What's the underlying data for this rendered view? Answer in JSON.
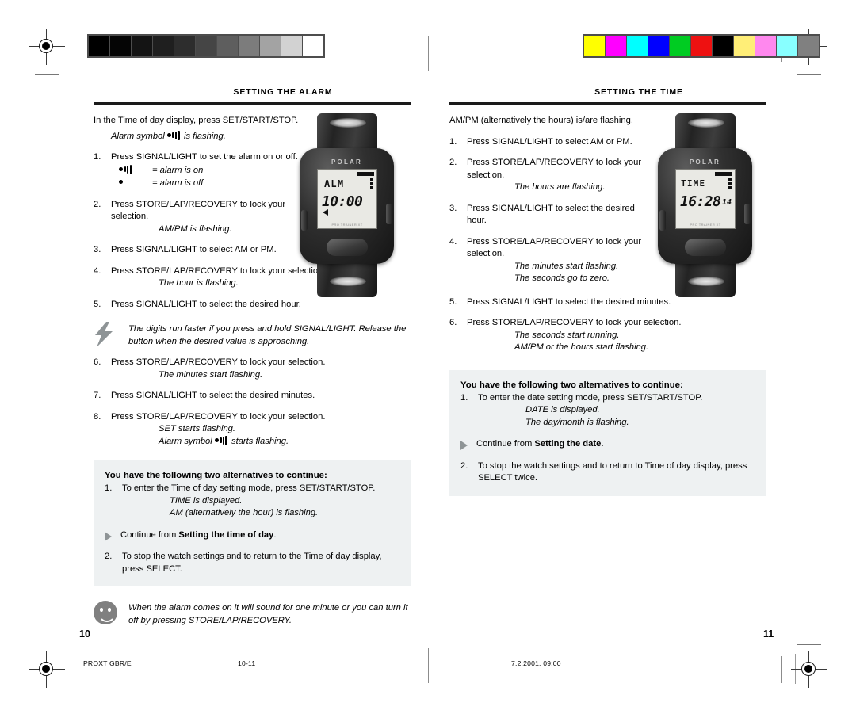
{
  "document": {
    "imposition_label": "PROXT GBR/E",
    "sheet_label": "10-11",
    "print_timestamp": "7.2.2001, 09:00"
  },
  "calibration": {
    "grayscale_patches": [
      "#000000",
      "#050505",
      "#141414",
      "#1f1f1f",
      "#2d2d2d",
      "#454545",
      "#5e5e5e",
      "#7c7c7c",
      "#a3a3a3",
      "#d2d2d2",
      "#ffffff"
    ],
    "color_patches": [
      "#ffff00",
      "#ff00ff",
      "#00ffff",
      "#0000ff",
      "#00cc22",
      "#ee1111",
      "#000000",
      "#ffee77",
      "#ff88ee",
      "#88ffff",
      "#808080"
    ]
  },
  "left_page": {
    "page_number": "10",
    "heading": "SETTING THE ALARM",
    "intro": "In the Time of day display, press SET/START/STOP.",
    "intro_note_prefix": "Alarm symbol",
    "intro_note_suffix": "is flashing.",
    "watch": {
      "brand": "POLAR",
      "lcd_mode": "ALM",
      "lcd_main": "10:00",
      "lcd_small": "",
      "lcd_foot": "PRO TRAINER XT"
    },
    "steps": [
      {
        "num": "1.",
        "text": "Press SIGNAL/LIGHT to set the alarm on or off.",
        "symbol_rows": [
          {
            "symbol": "alarm-on-icon",
            "label": "= alarm is on"
          },
          {
            "symbol": "alarm-off-icon",
            "label": "= alarm is off"
          }
        ],
        "subs": []
      },
      {
        "num": "2.",
        "text": "Press STORE/LAP/RECOVERY to lock your selection.",
        "subs": [
          "AM/PM is flashing."
        ]
      },
      {
        "num": "3.",
        "text": "Press SIGNAL/LIGHT to select AM or PM.",
        "subs": []
      },
      {
        "num": "4.",
        "text": "Press STORE/LAP/RECOVERY to lock your selection.",
        "subs": [
          "The hour is flashing."
        ]
      },
      {
        "num": "5.",
        "text": "Press SIGNAL/LIGHT to select the desired hour.",
        "subs": []
      },
      {
        "num": "6.",
        "text": "Press STORE/LAP/RECOVERY to lock your selection.",
        "subs": [
          "The minutes start flashing."
        ]
      },
      {
        "num": "7.",
        "text": "Press SIGNAL/LIGHT to select the desired minutes.",
        "subs": []
      },
      {
        "num": "8.",
        "text": "Press STORE/LAP/RECOVERY to lock your selection.",
        "subs": [
          "SET starts flashing."
        ],
        "sub_with_symbol": {
          "prefix": "Alarm symbol",
          "suffix": "starts flashing."
        }
      }
    ],
    "tip_bolt": "The digits run faster if you press and hold SIGNAL/LIGHT. Release the button when the desired value is approaching.",
    "alt_box": {
      "title": "You have the following two alternatives to continue:",
      "item1_num": "1.",
      "item1_text": "To enter the Time of day setting mode, press SET/START/STOP.",
      "item1_subs": [
        "TIME is displayed.",
        "AM (alternatively the hour) is flashing."
      ],
      "continue_prefix": "Continue from",
      "continue_bold": "Setting the time of day",
      "continue_suffix": ".",
      "item2_num": "2.",
      "item2_text": "To stop the watch settings and to return to the Time of day display, press SELECT."
    },
    "tip_smiley": "When the alarm comes on it will sound for one minute or you can turn it off by pressing STORE/LAP/RECOVERY."
  },
  "right_page": {
    "page_number": "11",
    "heading": "SETTING THE TIME",
    "intro": "AM/PM (alternatively the hours) is/are flashing.",
    "watch": {
      "brand": "POLAR",
      "lcd_mode": "TIME",
      "lcd_main": "16:28",
      "lcd_small": "14",
      "lcd_foot": "PRO TRAINER XT"
    },
    "steps": [
      {
        "num": "1.",
        "text": "Press SIGNAL/LIGHT to select AM or PM.",
        "subs": []
      },
      {
        "num": "2.",
        "text": "Press STORE/LAP/RECOVERY to lock your selection.",
        "subs": [
          "The hours are flashing."
        ]
      },
      {
        "num": "3.",
        "text": "Press SIGNAL/LIGHT to select the desired hour.",
        "subs": []
      },
      {
        "num": "4.",
        "text": "Press STORE/LAP/RECOVERY to lock your selection.",
        "subs": [
          "The minutes start flashing.",
          "The seconds go to zero."
        ]
      },
      {
        "num": "5.",
        "text": "Press SIGNAL/LIGHT to select the desired minutes.",
        "subs": []
      },
      {
        "num": "6.",
        "text": "Press STORE/LAP/RECOVERY to lock your selection.",
        "subs": [
          "The seconds start running.",
          "AM/PM or the hours start flashing."
        ]
      }
    ],
    "alt_box": {
      "title": "You have the following two alternatives to continue:",
      "item1_num": "1.",
      "item1_text": "To enter the date setting mode, press SET/START/STOP.",
      "item1_subs": [
        "DATE is displayed.",
        "The day/month is flashing."
      ],
      "continue_prefix": "Continue from",
      "continue_bold": "Setting the date.",
      "continue_suffix": "",
      "item2_num": "2.",
      "item2_text": "To stop the watch settings and to return to Time of day display, press SELECT twice."
    }
  }
}
